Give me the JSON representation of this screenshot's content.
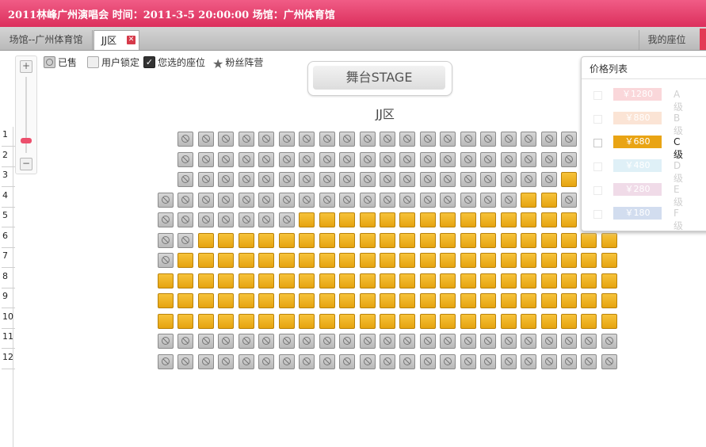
{
  "window": {
    "title": "2011林峰广州演唱会  时间：2011-3-5 20:00:00  场馆：广州体育馆"
  },
  "tabs": {
    "venue": "场馆--广州体育馆",
    "zone": "JJ区",
    "close_glyph": "✕",
    "my_seats": "我的座位"
  },
  "zoom": {
    "plus": "+",
    "minus": "−",
    "level": 0.15
  },
  "legend": {
    "sold": "已售",
    "locked": "用户锁定",
    "chosen": "您选的座位",
    "fan": "粉丝阵营"
  },
  "stage": {
    "label": "舞台STAGE"
  },
  "zone_title": "JJ区",
  "row_labels": [
    "1",
    "2",
    "3",
    "4",
    "5",
    "6",
    "7",
    "8",
    "9",
    "10",
    "11",
    "12"
  ],
  "seats": {
    "rows": [
      "SSSSSSSSSSSSSSSSSSSS",
      "SSSSSSSSSSSSSSSSSSSS",
      "SSSSSSSSSSSSSSSSSSSA",
      "SSSSSSSSSSSSSSSSSSAAS",
      "SSSSSSSAAAAAAAAAAAAAAS",
      "SSAAAAAAAAAAAAAAAAAAAAA",
      "SAAAAAAAAAAAAAAAAAAAAAA",
      "AAAAAAAAAAAAAAAAAAAAAAA",
      "AAAAAAAAAAAAAAAAAAAAAAA",
      "AAAAAAAAAAAAAAAAAAAAAAA",
      "SSSSSSSSSSSSSSSSSSSSSSS",
      "SSSSSSSSSSSSSSSSSSSSSSS"
    ],
    "row_offsets": [
      1,
      1,
      1,
      0,
      0,
      0,
      0,
      0,
      0,
      0,
      0,
      0
    ]
  },
  "price_list": {
    "title": "价格列表",
    "items": [
      {
        "price": "￥1280",
        "level": "A 级",
        "color": "#f18f98",
        "active": false
      },
      {
        "price": "￥880",
        "level": "B 级",
        "color": "#f6b58a",
        "active": false
      },
      {
        "price": "￥680",
        "level": "C 级",
        "color": "#e9a414",
        "active": true
      },
      {
        "price": "￥480",
        "level": "D 级",
        "color": "#a6d6ea",
        "active": false
      },
      {
        "price": "￥280",
        "level": "E 级",
        "color": "#d79ac0",
        "active": false
      },
      {
        "price": "￥180",
        "level": "F 级",
        "color": "#7f9fd4",
        "active": false
      }
    ]
  }
}
